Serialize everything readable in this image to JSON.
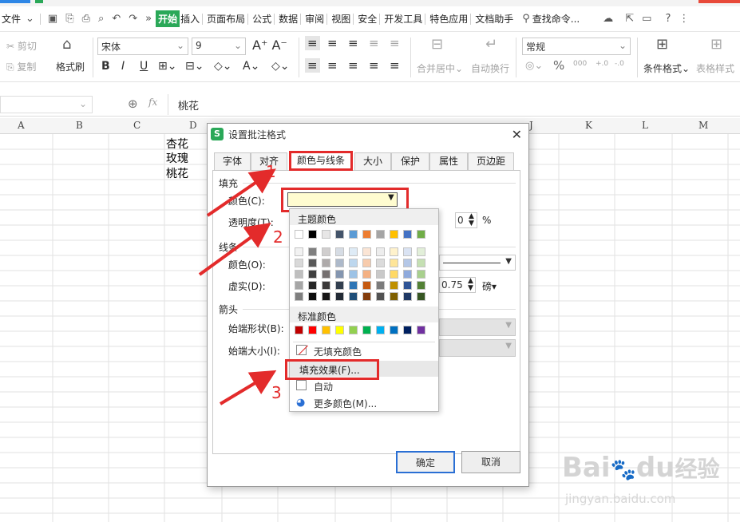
{
  "menubar": {
    "file": "文件",
    "items": [
      "开始",
      "插入",
      "页面布局",
      "公式",
      "数据",
      "审阅",
      "视图",
      "安全",
      "开发工具",
      "特色应用",
      "文档助手"
    ],
    "active": "开始",
    "search": "查找命令..."
  },
  "ribbon": {
    "cut": "剪切",
    "copy": "复制",
    "format_painter": "格式刷",
    "font_name": "宋体",
    "font_size": "9",
    "merge_center": "合并居中",
    "wrap": "自动换行",
    "number_format": "常规",
    "cond_format": "条件格式",
    "table_style": "表格样式",
    "bold": "B",
    "italic": "I",
    "underline": "U",
    "percent": "%",
    "thousands": "000",
    "inc_dec": "+.0",
    "dec_dec": "-.0"
  },
  "formula_bar": {
    "fx": "fx",
    "value": "桃花"
  },
  "columns": [
    "A",
    "B",
    "C",
    "D",
    "J",
    "K",
    "L",
    "M"
  ],
  "cells": [
    "杏花",
    "玫瑰",
    "桃花"
  ],
  "dialog": {
    "title": "设置批注格式",
    "tabs": [
      "字体",
      "对齐",
      "颜色与线条",
      "大小",
      "保护",
      "属性",
      "页边距"
    ],
    "active_tab": "颜色与线条",
    "fill_section": "填充",
    "color_label": "颜色(C):",
    "transparency_label": "透明度(T):",
    "transparency_unit": "%",
    "line_section": "线条",
    "line_color_label": "颜色(O):",
    "dash_label": "虚实(D):",
    "weight_value": "0.75",
    "weight_unit": "磅",
    "arrow_section": "箭头",
    "begin_style_label": "始端形状(B):",
    "begin_size_label": "始端大小(I):",
    "ok": "确定",
    "cancel": "取消",
    "fill_color": "#fffcd0"
  },
  "popup": {
    "theme_title": "主题颜色",
    "standard_title": "标准颜色",
    "no_fill": "无填充颜色",
    "fill_effects": "填充效果(F)...",
    "auto": "自动",
    "more_colors": "更多颜色(M)...",
    "theme_top": [
      "#ffffff",
      "#000000",
      "#e7e6e6",
      "#44546a",
      "#5b9bd5",
      "#ed7d31",
      "#a5a5a5",
      "#ffc000",
      "#4472c4",
      "#70ad47"
    ],
    "theme_shades": [
      [
        "#f2f2f2",
        "#7f7f7f",
        "#d0cece",
        "#d6dce4",
        "#deebf6",
        "#fbe5d5",
        "#ededed",
        "#fff2cc",
        "#dae3f3",
        "#e2efd9"
      ],
      [
        "#d9d9d9",
        "#595959",
        "#aeaaaa",
        "#adb9ca",
        "#bdd7ee",
        "#f7cbac",
        "#dbdbdb",
        "#fee599",
        "#b4c7e7",
        "#c5e0b3"
      ],
      [
        "#bfbfbf",
        "#404040",
        "#757070",
        "#8496b0",
        "#9dc3e6",
        "#f4b183",
        "#c9c9c9",
        "#ffd966",
        "#8faadc",
        "#a8d08d"
      ],
      [
        "#a6a6a6",
        "#262626",
        "#3a3838",
        "#323f4f",
        "#2e75b5",
        "#c55a11",
        "#7b7b7b",
        "#bf9000",
        "#2f5496",
        "#538135"
      ],
      [
        "#7f7f7f",
        "#0d0d0d",
        "#171616",
        "#222a35",
        "#1e4e79",
        "#833c0b",
        "#525252",
        "#7f6000",
        "#1f3864",
        "#375623"
      ]
    ],
    "standard": [
      "#c00000",
      "#ff0000",
      "#ffc000",
      "#ffff00",
      "#92d050",
      "#00b050",
      "#00b0f0",
      "#0070c0",
      "#002060",
      "#7030a0"
    ]
  },
  "annotations": {
    "n1": "1",
    "n2": "2",
    "n3": "3",
    "accent": "#e32b2b"
  },
  "watermark": {
    "brand": "Bai",
    "brand2": "du",
    "cn": "经验",
    "url": "jingyan.baidu.com"
  }
}
